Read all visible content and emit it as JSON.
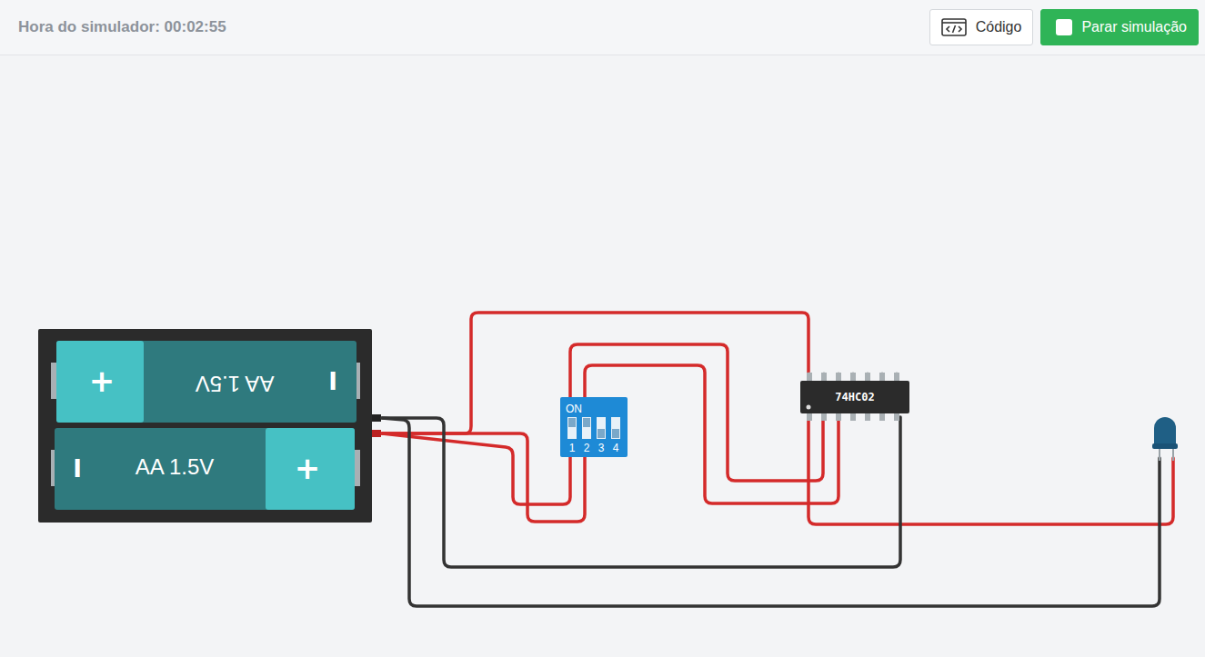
{
  "toolbar": {
    "simulator_time": "Hora do simulador: 00:02:55",
    "buttons": [
      {
        "label": "Código",
        "kind": "code"
      },
      {
        "label": "Parar simulação",
        "kind": "stop"
      }
    ]
  },
  "battery": {
    "cells": [
      {
        "label": "AA 1.5V",
        "plus": "+",
        "minus": "I",
        "flipped": true
      },
      {
        "label": "AA 1.5V",
        "plus": "+",
        "minus": "I",
        "flipped": false
      }
    ]
  },
  "dip_switch": {
    "label": "ON",
    "switches": [
      {
        "label": "1",
        "on": true
      },
      {
        "label": "2",
        "on": true
      },
      {
        "label": "3",
        "on": false
      },
      {
        "label": "4",
        "on": false
      }
    ]
  },
  "chip": {
    "label": "74HC02"
  },
  "led": {
    "on": false
  },
  "wires": [
    {
      "color": "#d42a2a"
    },
    {
      "color": "#d42a2a"
    },
    {
      "color": "#d42a2a"
    },
    {
      "color": "#d42a2a"
    },
    {
      "color": "#d42a2a"
    },
    {
      "color": "#d42a2a"
    },
    {
      "color": "#333333"
    },
    {
      "color": "#333333"
    }
  ]
}
